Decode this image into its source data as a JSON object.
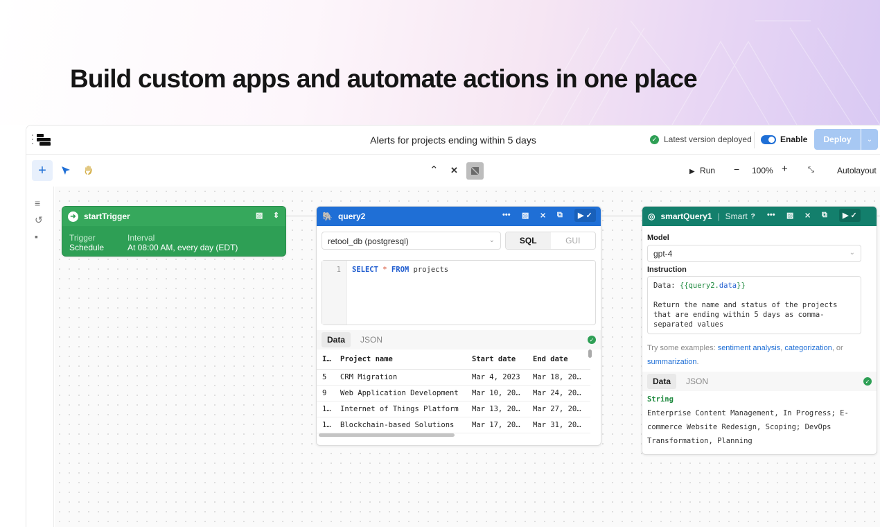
{
  "headline": "Build custom apps and automate actions in one place",
  "topbar": {
    "title": "Alerts for projects ending within 5 days",
    "status": "Latest version deployed",
    "enable_label": "Enable",
    "deploy_label": "Deploy"
  },
  "toolbar": {
    "run_label": "Run",
    "zoom": "100%",
    "autolayout_label": "Autolayout"
  },
  "trigger": {
    "name": "startTrigger",
    "col1_label": "Trigger",
    "col1_value": "Schedule",
    "col2_label": "Interval",
    "col2_value": "At 08:00 AM, every day (EDT)"
  },
  "query": {
    "name": "query2",
    "resource": "retool_db (postgresql)",
    "mode_sql": "SQL",
    "mode_gui": "GUI",
    "line_no": "1",
    "code_kw1": "SELECT",
    "code_op": "*",
    "code_kw2": "FROM",
    "code_rest": "projects",
    "tab_data": "Data",
    "tab_json": "JSON",
    "columns": [
      "I…",
      "Project name",
      "Start date",
      "End date"
    ],
    "rows": [
      [
        "5",
        "CRM Migration",
        "Mar 4, 2023",
        "Mar 18, 20…"
      ],
      [
        "9",
        "Web Application Development",
        "Mar 10, 20…",
        "Mar 24, 20…"
      ],
      [
        "1…",
        "Internet of Things Platform",
        "Mar 13, 20…",
        "Mar 27, 20…"
      ],
      [
        "1…",
        "Blockchain-based Solutions",
        "Mar 17, 20…",
        "Mar 31, 20…"
      ]
    ]
  },
  "smart": {
    "name": "smartQuery1",
    "badge": "Smart",
    "model_label": "Model",
    "model_value": "gpt-4",
    "instruction_label": "Instruction",
    "instr_prefix": "Data: ",
    "instr_tpl_open": "{{query2.",
    "instr_tpl_key": "data",
    "instr_tpl_close": "}}",
    "instr_body": "Return the name and status of the projects that are ending within 5 days as comma-separated values",
    "hint_prefix": "Try some examples: ",
    "hint_link1": "sentiment analysis",
    "hint_sep": ", ",
    "hint_link2": "categorization",
    "hint_mid": ", or ",
    "hint_link3": "summarization",
    "hint_end": ".",
    "tab_data": "Data",
    "tab_json": "JSON",
    "output_type": "String",
    "output_value": "Enterprise Content Management, In Progress; E-commerce Website Redesign, Scoping; DevOps Transformation, Planning"
  },
  "colors": {
    "trigger": "#2e9f55",
    "query": "#1f6fd6",
    "smart": "#137f6c",
    "deploy": "#a7c8f3"
  }
}
